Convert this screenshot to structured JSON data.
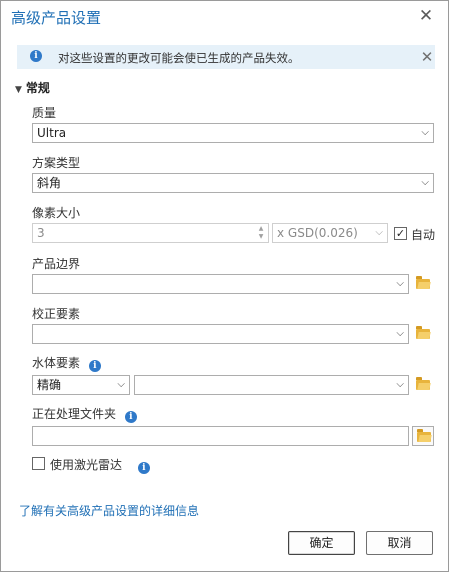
{
  "dialog": {
    "title": "高级产品设置",
    "close_glyph": "✕"
  },
  "info": {
    "message": "对这些设置的更改可能会使已生成的产品失效。",
    "dismiss_glyph": "✕"
  },
  "section": {
    "label": "常规",
    "expanded": true
  },
  "quality": {
    "label": "质量",
    "value": "Ultra"
  },
  "scheme_type": {
    "label": "方案类型",
    "value": "斜角"
  },
  "pixel_size": {
    "label": "像素大小",
    "value": "3",
    "unit": "x GSD(0.026)",
    "auto_label": "自动",
    "auto_checked": true
  },
  "product_boundary": {
    "label": "产品边界",
    "value": ""
  },
  "correction_features": {
    "label": "校正要素",
    "value": ""
  },
  "water_features": {
    "label": "水体要素",
    "mode_value": "精确",
    "layer_value": ""
  },
  "processing_folder": {
    "label": "正在处理文件夹",
    "value": ""
  },
  "lidar": {
    "label": "使用激光雷达",
    "checked": false
  },
  "learn_more": {
    "label": "了解有关高级产品设置的详细信息"
  },
  "buttons": {
    "ok_label": "确定",
    "cancel_label": "取消"
  },
  "icons": {
    "info": "info-icon",
    "folder": "folder-icon",
    "dropdown": "chevron-down-icon",
    "close": "close-icon"
  },
  "colors": {
    "accent": "#1f6fb5",
    "info_bar": "#e6f1f9",
    "info_icon": "#2f79c9",
    "folder": "#e8b43c"
  }
}
